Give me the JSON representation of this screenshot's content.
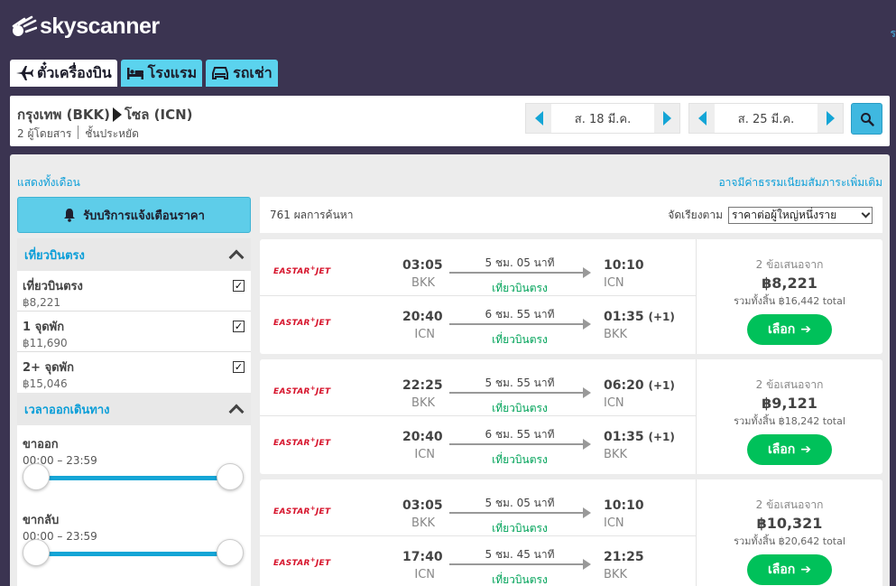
{
  "brand": {
    "name": "skyscanner",
    "top_right_letter": "ร"
  },
  "tabs": [
    {
      "label": "ตั๋วเครื่องบิน",
      "icon": "plane-icon",
      "active": true
    },
    {
      "label": "โรงแรม",
      "icon": "bed-icon",
      "active": false
    },
    {
      "label": "รถเช่า",
      "icon": "car-icon",
      "active": false
    }
  ],
  "search": {
    "origin": "กรุงเทพ (BKK)",
    "destination": "โซล (ICN)",
    "passengers": "2 ผู้โดยสาร",
    "cabin": "ชั้นประหยัด",
    "depart_date": "ส. 18 มี.ค.",
    "return_date": "ส. 25 มี.ค."
  },
  "links": {
    "show_month": "แสดงทั้งเดือน",
    "fees_note": "อาจมีค่าธรรมเนียมสัมภาระเพิ่มเติม"
  },
  "sidebar": {
    "alert_button": "รับบริการแจ้งเตือนราคา",
    "stops_header": "เที่ยวบินตรง",
    "stops": [
      {
        "label": "เที่ยวบินตรง",
        "price": "฿8,221",
        "checked": true
      },
      {
        "label": "1 จุดพัก",
        "price": "฿11,690",
        "checked": true
      },
      {
        "label": "2+ จุดพัก",
        "price": "฿15,046",
        "checked": true
      }
    ],
    "times_header": "เวลาออกเดินทาง",
    "outbound": {
      "label": "ขาออก",
      "range": "00:00 – 23:59"
    },
    "inbound": {
      "label": "ขากลับ",
      "range": "00:00 – 23:59"
    }
  },
  "results": {
    "count": "761 ผลการค้นหา",
    "sort_label": "จัดเรียงตาม",
    "sort_value": "ราคาต่อผู้ใหญ่หนึ่งราย",
    "cards": [
      {
        "legs": [
          {
            "airline": "EASTAR",
            "airline_suffix": "JET",
            "dep_time": "03:05",
            "dep_code": "BKK",
            "duration": "5 ชม. 05 นาที",
            "stops": "เที่ยวบินตรง",
            "arr_time": "10:10",
            "arr_plus": "",
            "arr_code": "ICN"
          },
          {
            "airline": "EASTAR",
            "airline_suffix": "JET",
            "dep_time": "20:40",
            "dep_code": "ICN",
            "duration": "6 ชม. 55 นาที",
            "stops": "เที่ยวบินตรง",
            "arr_time": "01:35",
            "arr_plus": "(+1)",
            "arr_code": "BKK"
          }
        ],
        "offers": "2 ข้อเสนอจาก",
        "price": "฿8,221",
        "total": "รวมทั้งสิ้น ฿16,442 total",
        "button": "เลือก"
      },
      {
        "legs": [
          {
            "airline": "EASTAR",
            "airline_suffix": "JET",
            "dep_time": "22:25",
            "dep_code": "BKK",
            "duration": "5 ชม. 55 นาที",
            "stops": "เที่ยวบินตรง",
            "arr_time": "06:20",
            "arr_plus": "(+1)",
            "arr_code": "ICN"
          },
          {
            "airline": "EASTAR",
            "airline_suffix": "JET",
            "dep_time": "20:40",
            "dep_code": "ICN",
            "duration": "6 ชม. 55 นาที",
            "stops": "เที่ยวบินตรง",
            "arr_time": "01:35",
            "arr_plus": "(+1)",
            "arr_code": "BKK"
          }
        ],
        "offers": "2 ข้อเสนอจาก",
        "price": "฿9,121",
        "total": "รวมทั้งสิ้น ฿18,242 total",
        "button": "เลือก"
      },
      {
        "legs": [
          {
            "airline": "EASTAR",
            "airline_suffix": "JET",
            "dep_time": "03:05",
            "dep_code": "BKK",
            "duration": "5 ชม. 05 นาที",
            "stops": "เที่ยวบินตรง",
            "arr_time": "10:10",
            "arr_plus": "",
            "arr_code": "ICN"
          },
          {
            "airline": "EASTAR",
            "airline_suffix": "JET",
            "dep_time": "17:40",
            "dep_code": "ICN",
            "duration": "5 ชม. 45 นาที",
            "stops": "เที่ยวบินตรง",
            "arr_time": "21:25",
            "arr_plus": "",
            "arr_code": "BKK"
          }
        ],
        "offers": "2 ข้อเสนอจาก",
        "price": "฿10,321",
        "total": "รวมทั้งสิ้น ฿20,642 total",
        "button": "เลือก"
      }
    ]
  },
  "colors": {
    "header_bg": "#3b3451",
    "accent_blue": "#14a5d6",
    "tab_cyan": "#5bd3ee",
    "select_green": "#00c15a",
    "direct_green": "#00a359",
    "airline_red": "#d6122a"
  }
}
